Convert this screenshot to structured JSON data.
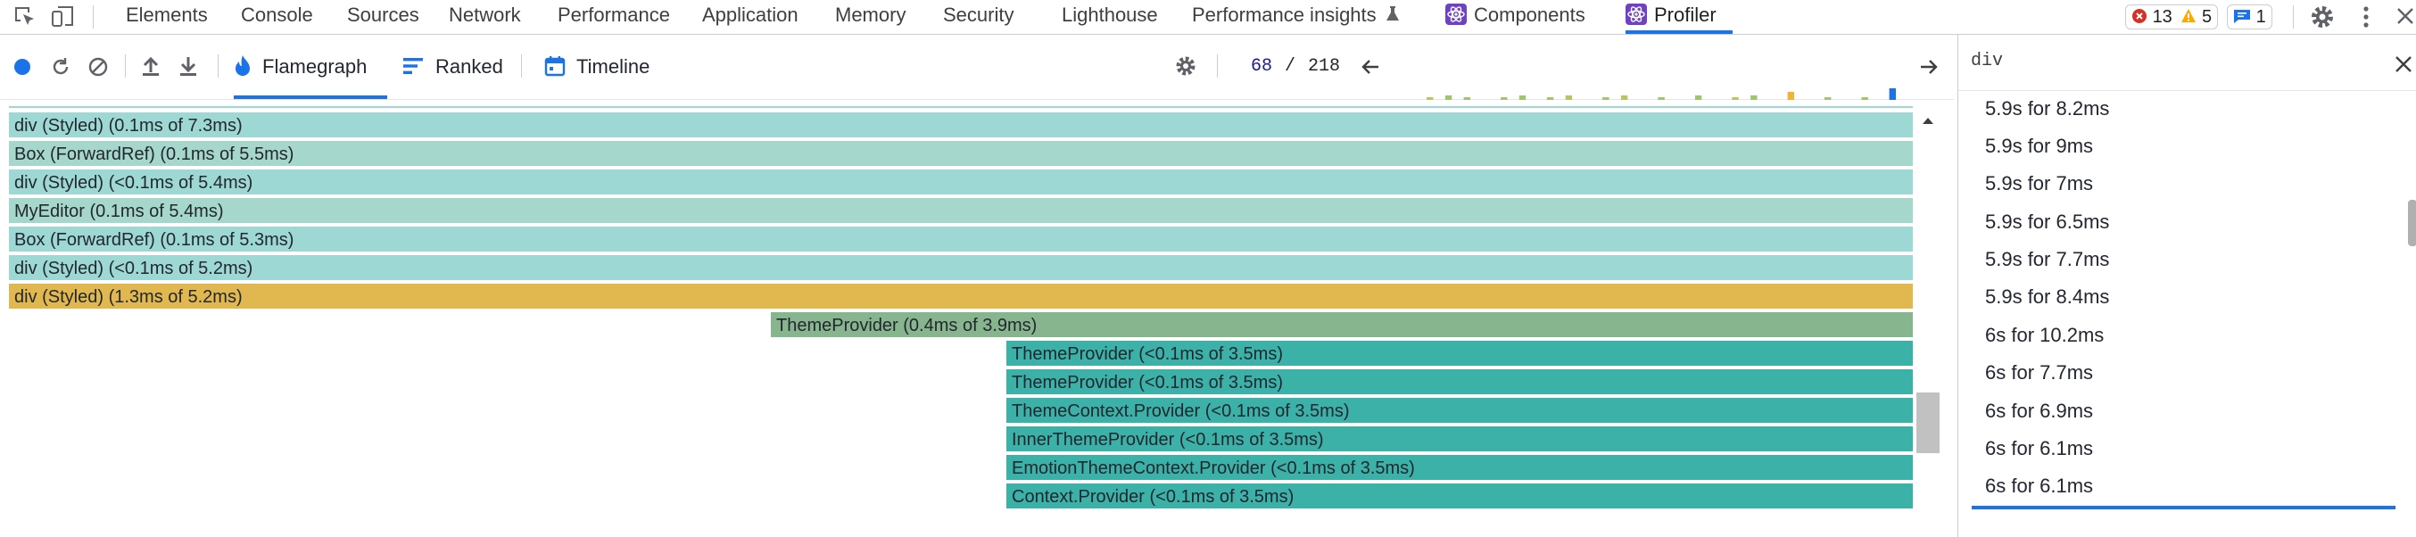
{
  "tabs": [
    {
      "label": "Elements"
    },
    {
      "label": "Console"
    },
    {
      "label": "Sources"
    },
    {
      "label": "Network"
    },
    {
      "label": "Performance"
    },
    {
      "label": "Application"
    },
    {
      "label": "Memory"
    },
    {
      "label": "Security"
    },
    {
      "label": "Lighthouse"
    },
    {
      "label": "Performance insights"
    },
    {
      "label": "Components"
    },
    {
      "label": "Profiler"
    }
  ],
  "badges": {
    "errors": "13",
    "warnings": "5",
    "messages": "1"
  },
  "toolbar": {
    "flamegraph": "Flamegraph",
    "ranked": "Ranked",
    "timeline": "Timeline",
    "commit_current": "68",
    "commit_sep": "/",
    "commit_total": "218"
  },
  "commit_bars": [
    0.55,
    0.7,
    0.6,
    0.75,
    0.6,
    0.8,
    0.65,
    0.75,
    0.6,
    0.7,
    0.55,
    0.75,
    0.65,
    0.8,
    0.6,
    0.7,
    0.75,
    0.6,
    0.8,
    0.65,
    0.7,
    0.55,
    0.75,
    0.6,
    0.8,
    0.65,
    0.7,
    0.6,
    0.75,
    0.6,
    0.7,
    0.65,
    0.8,
    0.6,
    0.7,
    0.55,
    0.75,
    0.6,
    0.8,
    0.65,
    0.7,
    0.6,
    0.9,
    0.65,
    0.7,
    0.6,
    0.75,
    0.55,
    0.7,
    0.6,
    0.75,
    0.65,
    0.6,
    1.0
  ],
  "flame": [
    {
      "label": "div (Styled) (0.1ms of 7.3ms)",
      "color": "#9ed8d4"
    },
    {
      "label": "Box (ForwardRef) (0.1ms of 5.5ms)",
      "color": "#a6d7cc"
    },
    {
      "label": "div (Styled) (<0.1ms of 5.4ms)",
      "color": "#9ed8d4"
    },
    {
      "label": "MyEditor (0.1ms of 5.4ms)",
      "color": "#a6d7cc"
    },
    {
      "label": "Box (ForwardRef) (0.1ms of 5.3ms)",
      "color": "#9ed8d4"
    },
    {
      "label": "div (Styled) (<0.1ms of 5.2ms)",
      "color": "#9ed8d4"
    },
    {
      "label": "div (Styled) (1.3ms of 5.2ms)",
      "color": "#e0b84f"
    },
    {
      "label": "ThemeProvider (0.4ms of 3.9ms)",
      "color": "#86b58e"
    },
    {
      "label": "ThemeProvider (<0.1ms of 3.5ms)",
      "color": "#3bb1a8"
    },
    {
      "label": "ThemeProvider (<0.1ms of 3.5ms)",
      "color": "#3bb1a8"
    },
    {
      "label": "ThemeContext.Provider (<0.1ms of 3.5ms)",
      "color": "#3bb1a8"
    },
    {
      "label": "InnerThemeProvider (<0.1ms of 3.5ms)",
      "color": "#3bb1a8"
    },
    {
      "label": "EmotionThemeContext.Provider (<0.1ms of 3.5ms)",
      "color": "#3bb1a8"
    },
    {
      "label": "Context.Provider (<0.1ms of 3.5ms)",
      "color": "#3bb1a8"
    }
  ],
  "sidebar": {
    "search_value": "div",
    "commits": [
      "5.9s for 8.2ms",
      "5.9s for 9ms",
      "5.9s for 7ms",
      "5.9s for 6.5ms",
      "5.9s for 7.7ms",
      "5.9s for 8.4ms",
      "6s for 10.2ms",
      "6s for 7.7ms",
      "6s for 6.9ms",
      "6s for 6.1ms",
      "6s for 6.1ms"
    ]
  }
}
